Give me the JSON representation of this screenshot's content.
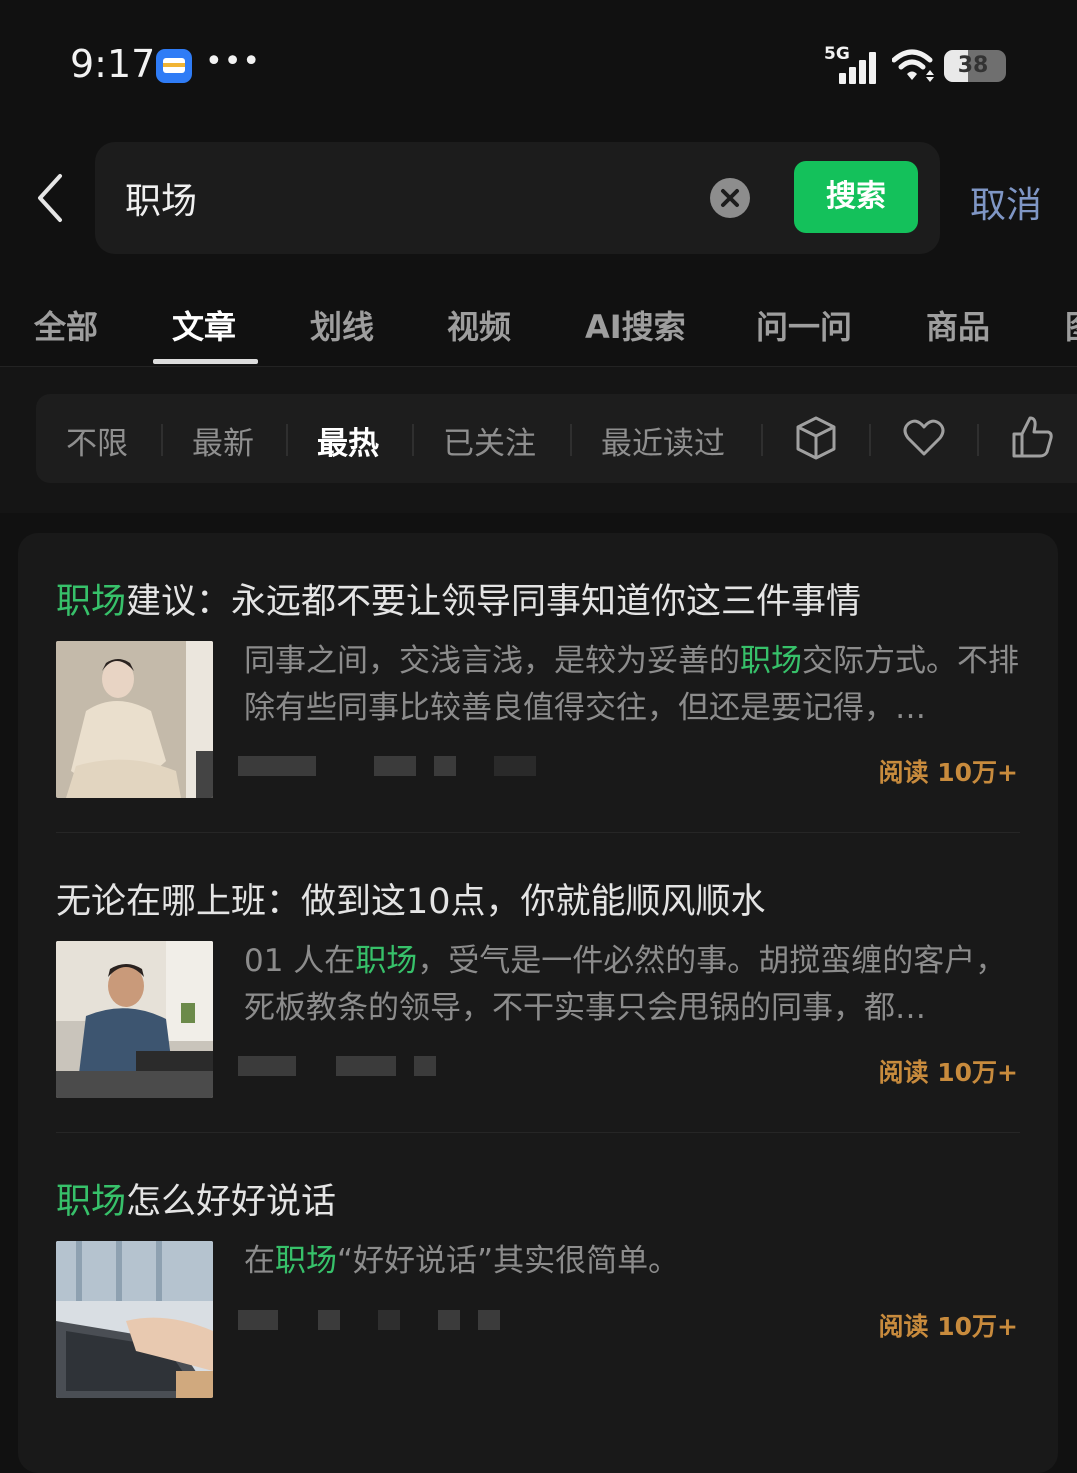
{
  "status_bar": {
    "time": "9:17",
    "network": "5G",
    "battery": "38",
    "battery_level": 0.38,
    "icons": [
      "wallet-icon",
      "more-dots-icon",
      "signal-icon",
      "wifi-icon",
      "battery-icon"
    ]
  },
  "search": {
    "query": "职场",
    "button_label": "搜索",
    "cancel_label": "取消",
    "colors": {
      "button": "#14c15b",
      "cancel": "#7f96c5"
    }
  },
  "tabs": [
    {
      "label": "全部"
    },
    {
      "label": "文章",
      "active": true
    },
    {
      "label": "划线"
    },
    {
      "label": "视频"
    },
    {
      "label": "AI搜索"
    },
    {
      "label": "问一问"
    },
    {
      "label": "商品"
    },
    {
      "label": "图"
    }
  ],
  "filters": [
    {
      "label": "不限"
    },
    {
      "label": "最新"
    },
    {
      "label": "最热",
      "active": true
    },
    {
      "label": "已关注"
    },
    {
      "label": "最近读过"
    }
  ],
  "filter_icons": [
    "cube-icon",
    "heart-icon",
    "thumbs-up-icon"
  ],
  "results": [
    {
      "title_highlight": "职场",
      "title_rest": "建议：永远都不要让领导同事知道你这三件事情",
      "snippet_pre": "同事之间，交浅言浅，是较为妥善的",
      "snippet_highlight": "职场",
      "snippet_post": "交际方式。不排除有些同事比较善良值得交往，但还是要记得，…",
      "read_count": "阅读 10万+"
    },
    {
      "title_highlight": "",
      "title_rest": "无论在哪上班：做到这10点，你就能顺风顺水",
      "snippet_pre": "01 人在",
      "snippet_highlight": "职场",
      "snippet_post": "，受气是一件必然的事。胡搅蛮缠的客户，死板教条的领导，不干实事只会甩锅的同事，都…",
      "read_count": "阅读 10万+"
    },
    {
      "title_highlight": "职场",
      "title_rest": "怎么好好说话",
      "snippet_pre": "在",
      "snippet_highlight": "职场",
      "snippet_post": "“好好说话”其实很简单。",
      "read_count": "阅读 10万+"
    }
  ],
  "colors": {
    "highlight": "#37c16a",
    "read_count": "#c88b3d",
    "background": "#111111"
  }
}
